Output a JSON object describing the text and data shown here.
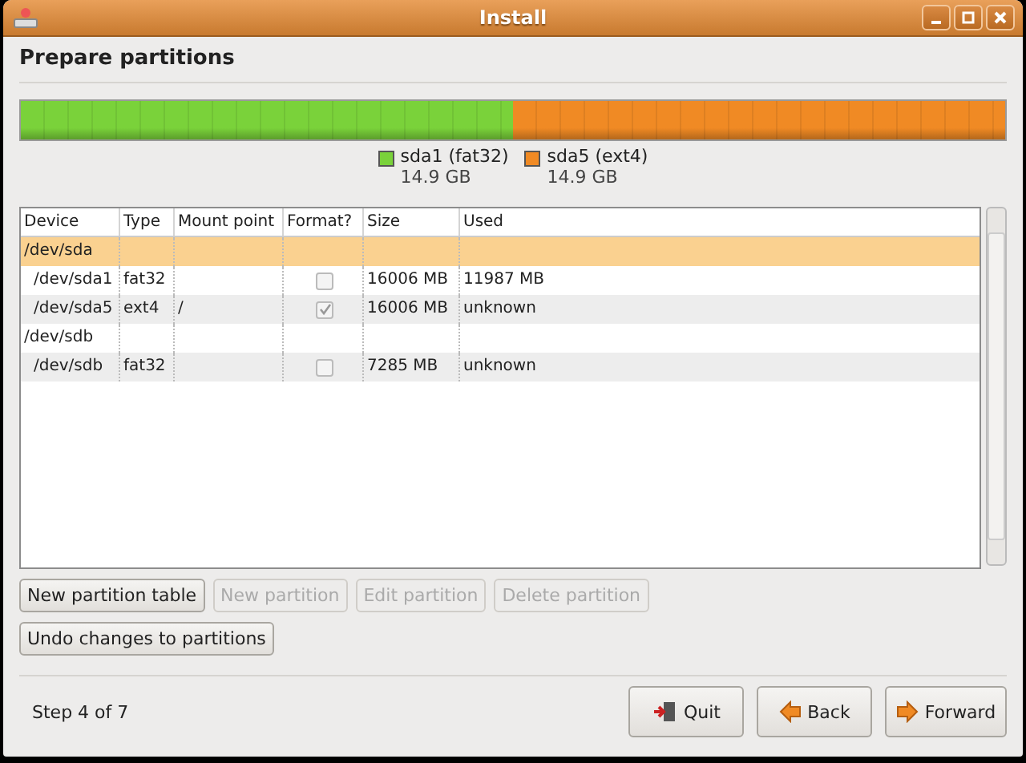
{
  "window": {
    "title": "Install"
  },
  "heading": "Prepare partitions",
  "partition_bar": {
    "segments": [
      {
        "name": "sda1 (fat32)",
        "size": "14.9 GB",
        "color": "#7ad23a",
        "level": 0.5
      },
      {
        "name": "sda5 (ext4)",
        "size": "14.9 GB",
        "color": "#f08a24",
        "level": 0.5
      }
    ]
  },
  "table": {
    "columns": [
      "Device",
      "Type",
      "Mount point",
      "Format?",
      "Size",
      "Used"
    ],
    "rows": [
      {
        "kind": "disk",
        "device": "/dev/sda",
        "selected": true
      },
      {
        "kind": "partition",
        "device": "/dev/sda1",
        "type": "fat32",
        "format": false,
        "size": "16006 MB",
        "used": "11987 MB",
        "selected": false
      },
      {
        "kind": "partition",
        "device": "/dev/sda5",
        "type": "ext4",
        "mount_point": "/",
        "format": true,
        "size": "16006 MB",
        "used": "unknown",
        "selected": false
      },
      {
        "kind": "disk",
        "device": "/dev/sdb",
        "selected": false
      },
      {
        "kind": "partition",
        "device": "/dev/sdb",
        "type": "fat32",
        "format": false,
        "size": "7285 MB",
        "used": "unknown",
        "selected": false
      }
    ]
  },
  "partition_buttons": [
    {
      "label": "New partition table",
      "disabled": false
    },
    {
      "label": "New partition",
      "disabled": true
    },
    {
      "label": "Edit partition",
      "disabled": true
    },
    {
      "label": "Delete partition",
      "disabled": true
    }
  ],
  "undo_button": {
    "label": "Undo changes to partitions",
    "disabled": false
  },
  "step": "Step 4 of 7",
  "nav_buttons": [
    {
      "label": "Quit",
      "kind": "quit"
    },
    {
      "label": "Back",
      "kind": "back"
    },
    {
      "label": "Forward",
      "kind": "forward"
    }
  ]
}
